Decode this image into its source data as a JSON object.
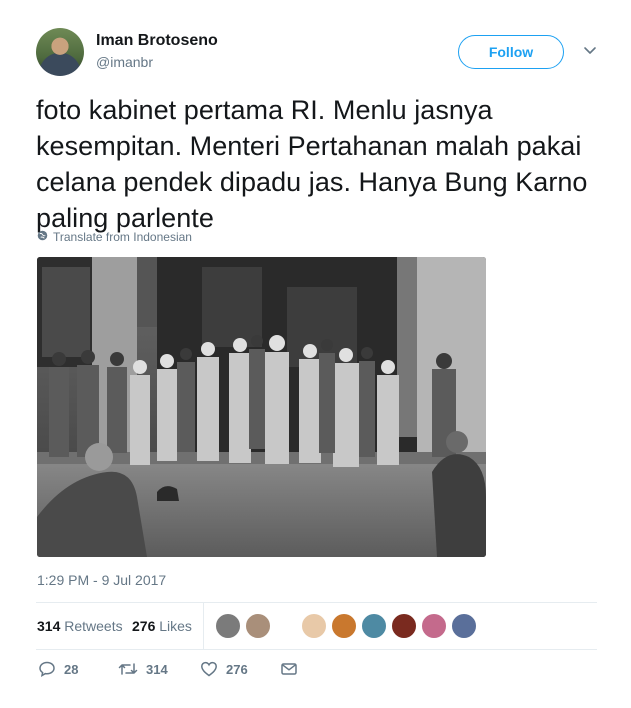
{
  "author": {
    "name": "Iman Brotoseno",
    "handle": "@imanbr"
  },
  "follow_label": "Follow",
  "tweet": {
    "text": "foto kabinet pertama RI. Menlu jasnya kesempitan. Menteri Pertahanan malah pakai celana pendek dipadu jas. Hanya Bung Karno paling parlente",
    "translate_label": "Translate from Indonesian",
    "timestamp": "1:29 PM - 9 Jul 2017"
  },
  "stats": {
    "retweets_count": "314",
    "retweets_label": "Retweets",
    "likes_count": "276",
    "likes_label": "Likes"
  },
  "actions": {
    "reply_count": "28",
    "retweet_count": "314",
    "like_count": "276"
  },
  "icons": [
    "chevron-down-icon",
    "globe-icon",
    "reply-icon",
    "retweet-icon",
    "heart-icon",
    "envelope-icon"
  ],
  "colors": {
    "accent": "#1da1f2",
    "secondary_text": "#657786",
    "primary_text": "#14171a",
    "border": "#e6ecf0"
  }
}
